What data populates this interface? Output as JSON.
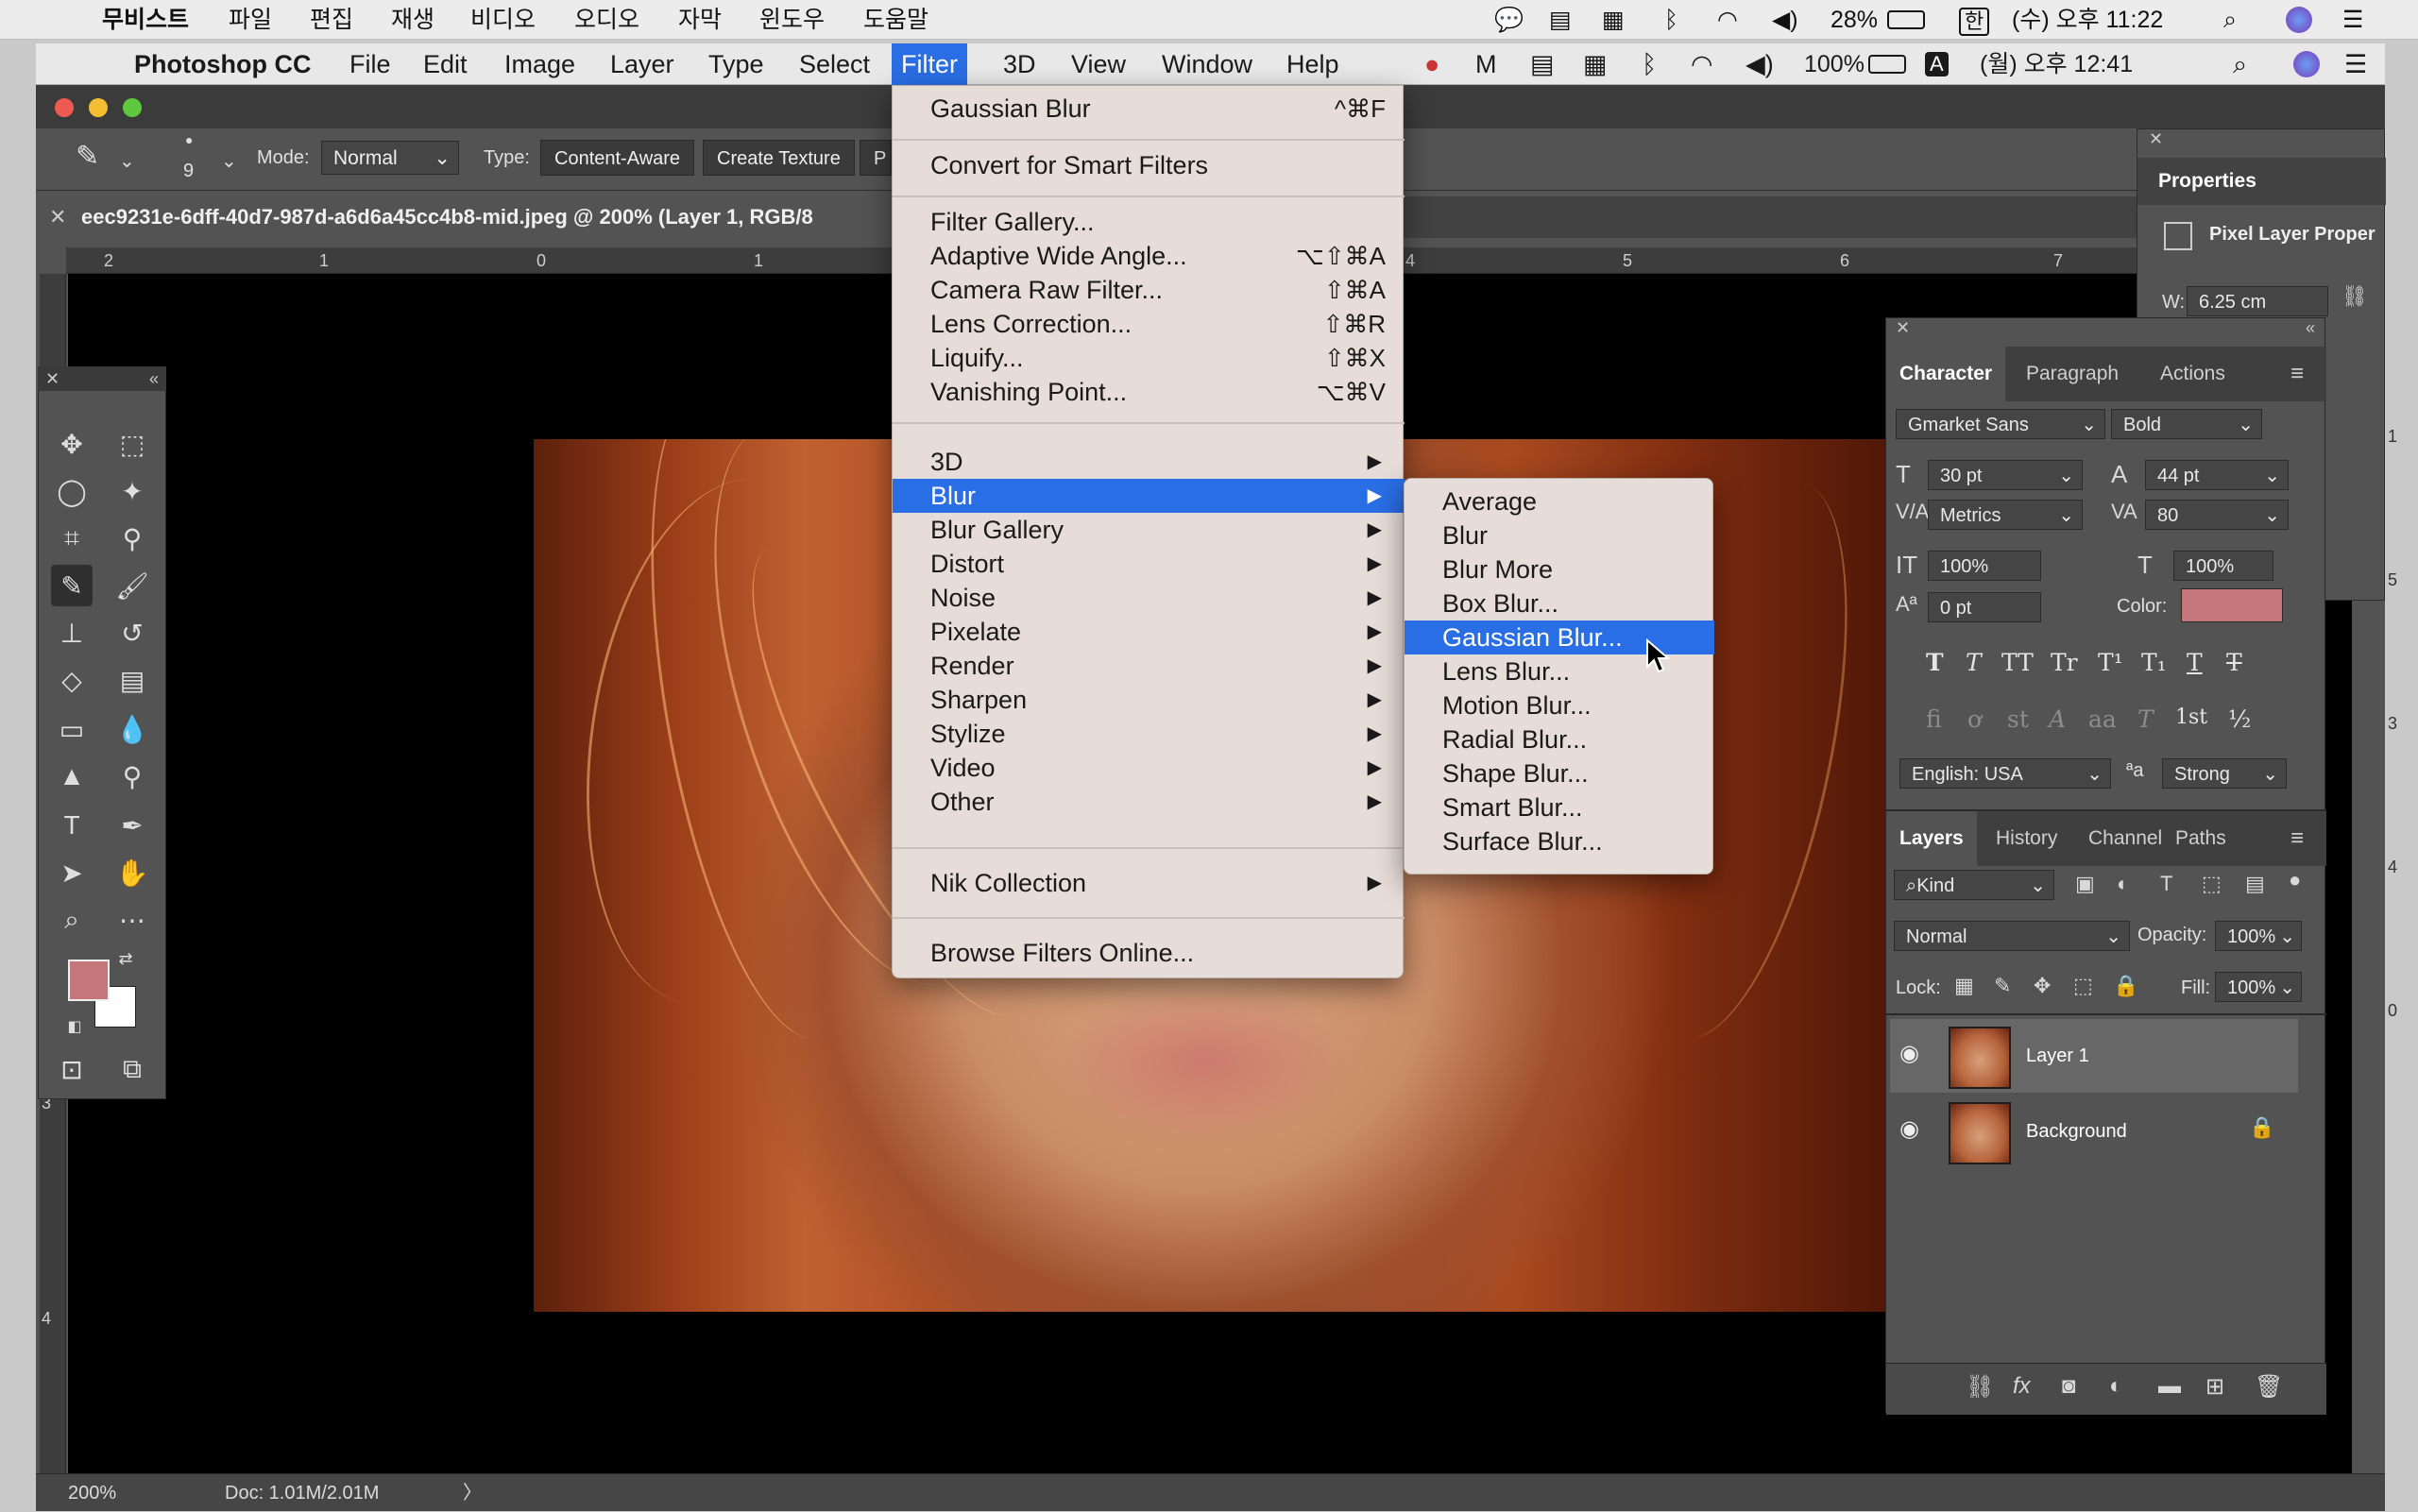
{
  "outer_menubar": {
    "app_name": "무비스트",
    "menus": [
      "파일",
      "편집",
      "재생",
      "비디오",
      "오디오",
      "자막",
      "윈도우",
      "도움말"
    ],
    "battery": "28%",
    "input_lang": "한",
    "clock": "(수) 오후 11:22"
  },
  "ps_menubar": {
    "app_name": "Photoshop CC",
    "menus": [
      "File",
      "Edit",
      "Image",
      "Layer",
      "Type",
      "Select",
      "Filter",
      "3D",
      "View",
      "Window",
      "Help"
    ],
    "battery": "100%",
    "input_lang": "A",
    "clock": "(월) 오후 12:41"
  },
  "options_bar": {
    "brush_size": "9",
    "mode_label": "Mode:",
    "mode_value": "Normal",
    "type_label": "Type:",
    "type_buttons": [
      "Content-Aware",
      "Create Texture",
      "P"
    ]
  },
  "document": {
    "tab_title": "eec9231e-6dff-40d7-987d-a6d6a45cc4b8-mid.jpeg @ 200% (Layer 1, RGB/8",
    "ruler_h": [
      "2",
      "1",
      "0",
      "1",
      "4",
      "5",
      "6",
      "7"
    ],
    "ruler_v": [
      "3",
      "4"
    ],
    "right_edge_marks": [
      "1",
      "5",
      "3",
      "4",
      "0"
    ]
  },
  "status": {
    "zoom": "200%",
    "doc_size": "Doc: 1.01M/2.01M",
    "arrow": "〉"
  },
  "filter_menu": {
    "last_filter": {
      "label": "Gaussian Blur",
      "shortcut": "^⌘F"
    },
    "smart": "Convert for Smart Filters",
    "gallery_items": [
      {
        "label": "Filter Gallery...",
        "shortcut": ""
      },
      {
        "label": "Adaptive Wide Angle...",
        "shortcut": "⌥⇧⌘A"
      },
      {
        "label": "Camera Raw Filter...",
        "shortcut": "⇧⌘A"
      },
      {
        "label": "Lens Correction...",
        "shortcut": "⇧⌘R"
      },
      {
        "label": "Liquify...",
        "shortcut": "⇧⌘X"
      },
      {
        "label": "Vanishing Point...",
        "shortcut": "⌥⌘V"
      }
    ],
    "submenus": [
      "3D",
      "Blur",
      "Blur Gallery",
      "Distort",
      "Noise",
      "Pixelate",
      "Render",
      "Sharpen",
      "Stylize",
      "Video",
      "Other"
    ],
    "nik": "Nik Collection",
    "browse": "Browse Filters Online...",
    "highlighted": "Blur"
  },
  "blur_submenu": {
    "items": [
      "Average",
      "Blur",
      "Blur More",
      "Box Blur...",
      "Gaussian Blur...",
      "Lens Blur...",
      "Motion Blur...",
      "Radial Blur...",
      "Shape Blur...",
      "Smart Blur...",
      "Surface Blur..."
    ],
    "highlighted": "Gaussian Blur..."
  },
  "properties_panel": {
    "title": "Properties",
    "subtitle": "Pixel Layer Proper",
    "w_label": "W:",
    "w_value": "6.25 cm"
  },
  "character_panel": {
    "tabs": [
      "Character",
      "Paragraph",
      "Actions"
    ],
    "font_family": "Gmarket Sans",
    "font_style": "Bold",
    "font_size": "30 pt",
    "leading": "44 pt",
    "kerning": "Metrics",
    "tracking": "80",
    "vertical_scale": "100%",
    "horizontal_scale": "100%",
    "baseline_shift": "0 pt",
    "color_label": "Color:",
    "color_value": "#c4777a",
    "language": "English: USA",
    "aa_label": "ªa",
    "antialias": "Strong",
    "style_glyphs": [
      "T",
      "T",
      "TT",
      "Tr",
      "T¹",
      "T₁",
      "T",
      "T"
    ],
    "opentype_glyphs": [
      "fi",
      "ơ",
      "st",
      "A",
      "aa",
      "T",
      "1st",
      "½"
    ]
  },
  "layers_panel": {
    "tabs": [
      "Layers",
      "History",
      "Channel",
      "Paths"
    ],
    "filter_kind": "Kind",
    "blend_mode": "Normal",
    "opacity_label": "Opacity:",
    "opacity": "100%",
    "lock_label": "Lock:",
    "fill_label": "Fill:",
    "fill": "100%",
    "layers": [
      {
        "name": "Layer 1",
        "selected": true,
        "locked": false
      },
      {
        "name": "Background",
        "selected": false,
        "locked": true
      }
    ]
  },
  "colors": {
    "menu_highlight": "#2a6ee5",
    "foreground_swatch": "#c4777a",
    "background_swatch": "#ffffff"
  }
}
